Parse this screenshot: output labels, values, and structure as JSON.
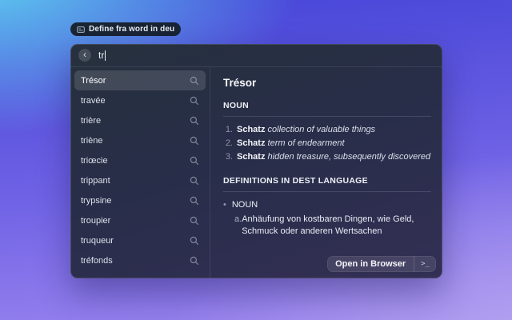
{
  "colors": {
    "bg_top_left": "#61dbf3",
    "bg_top_right": "#4545d8",
    "bg_bottom_left": "#9c86ef",
    "bg_bottom_right": "#b7a7f0",
    "window_top": "#26303d",
    "window_bottom": "#332f55",
    "selection": "#4a5160"
  },
  "badge": {
    "label": "Define fra word in deu"
  },
  "search": {
    "value": "tr",
    "back_glyph": "‹"
  },
  "results": [
    {
      "label": "Trésor",
      "selected": true
    },
    {
      "label": "travée",
      "selected": false
    },
    {
      "label": "trière",
      "selected": false
    },
    {
      "label": "triène",
      "selected": false
    },
    {
      "label": "triœcie",
      "selected": false
    },
    {
      "label": "trippant",
      "selected": false
    },
    {
      "label": "trypsine",
      "selected": false
    },
    {
      "label": "troupier",
      "selected": false
    },
    {
      "label": "truqueur",
      "selected": false
    },
    {
      "label": "tréfonds",
      "selected": false
    }
  ],
  "detail": {
    "title": "Trésor",
    "noun_section": {
      "heading": "NOUN",
      "items": [
        {
          "num": "1.",
          "term": "Schatz",
          "text": "collection of valuable things"
        },
        {
          "num": "2.",
          "term": "Schatz",
          "text": "term of endearment"
        },
        {
          "num": "3.",
          "term": "Schatz",
          "text": "hidden treasure, subsequently discovered"
        }
      ]
    },
    "dest_section": {
      "heading": "DEFINITIONS IN DEST LANGUAGE",
      "bullet": "•",
      "pos": "NOUN",
      "sub_label": "a.",
      "sub_text": "Anhäufung von kostbaren Dingen, wie Geld, Schmuck oder anderen Wertsachen"
    }
  },
  "footer": {
    "open_label": "Open in Browser",
    "shortcut": ">_"
  }
}
